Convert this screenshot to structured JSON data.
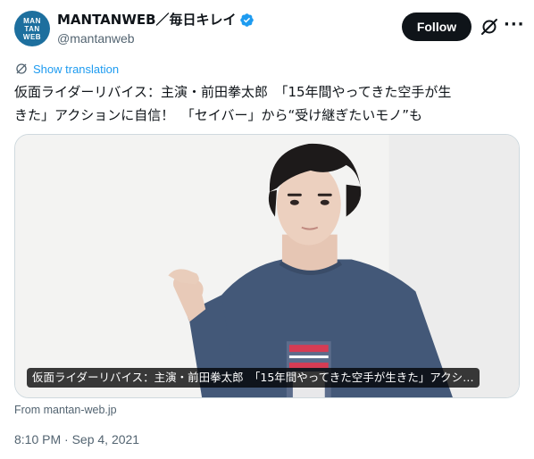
{
  "author": {
    "avatar_lines": [
      "MAN",
      "TAN",
      "WEB"
    ],
    "display_name": "MANTANWEB／毎日キレイ",
    "handle": "@mantanweb",
    "verified": true
  },
  "actions": {
    "follow_label": "Follow",
    "grok_icon": "grok-icon",
    "more_label": "···"
  },
  "translation": {
    "label": "Show translation",
    "icon": "translate-icon"
  },
  "tweet": {
    "text_line1": "仮面ライダーリバイス：主演・前田拳太郎　「15年間やってきた空手が生",
    "text_line2": "きた」アクションに自信！　「セイバー」から“受け継ぎたいモノ”も"
  },
  "card": {
    "caption": "仮面ライダーリバイス：主演・前田拳太郎　「15年間やってきた空手が生きた」アクシ…",
    "source": "From mantan-web.jp"
  },
  "timestamp": "8:10 PM · Sep 4, 2021",
  "colors": {
    "accent": "#1d9bf0",
    "avatar_bg": "#1d6f9e",
    "shirt": "#435878"
  }
}
